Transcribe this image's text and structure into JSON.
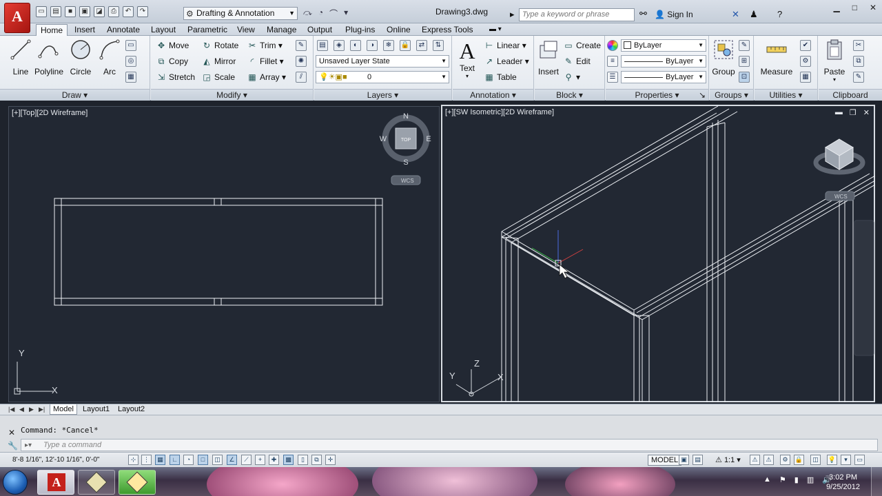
{
  "app": {
    "logo_letter": "A",
    "workspace": "Drafting & Annotation",
    "document_title": "Drawing3.dwg",
    "search_placeholder": "Type a keyword or phrase",
    "sign_in": "Sign In"
  },
  "ribbon_tabs": [
    "Home",
    "Insert",
    "Annotate",
    "Layout",
    "Parametric",
    "View",
    "Manage",
    "Output",
    "Plug-ins",
    "Online",
    "Express Tools"
  ],
  "active_tab": "Home",
  "draw_panel": {
    "title": "Draw",
    "buttons": [
      "Line",
      "Polyline",
      "Circle",
      "Arc"
    ]
  },
  "modify_panel": {
    "title": "Modify",
    "buttons": [
      "Move",
      "Rotate",
      "Trim",
      "Copy",
      "Mirror",
      "Fillet",
      "Stretch",
      "Scale",
      "Array"
    ]
  },
  "layers_panel": {
    "title": "Layers",
    "layer_state": "Unsaved Layer State",
    "current_layer": "0"
  },
  "annotation_panel": {
    "title": "Annotation",
    "text_label": "Text",
    "buttons": [
      "Linear",
      "Leader",
      "Table"
    ]
  },
  "block_panel": {
    "title": "Block",
    "insert_label": "Insert",
    "buttons": [
      "Create",
      "Edit"
    ]
  },
  "properties_panel": {
    "title": "Properties",
    "color": "ByLayer",
    "linetype": "ByLayer",
    "lineweight": "ByLayer"
  },
  "groups_panel": {
    "title": "Groups",
    "group_label": "Group"
  },
  "utilities_panel": {
    "title": "Utilities",
    "measure_label": "Measure"
  },
  "clipboard_panel": {
    "title": "Clipboard",
    "paste_label": "Paste"
  },
  "viewports": {
    "left_label": "[+][Top][2D Wireframe]",
    "right_label": "[+][SW Isometric][2D Wireframe]",
    "compass": {
      "n": "N",
      "s": "S",
      "e": "E",
      "w": "W",
      "top": "TOP"
    },
    "wcs": "WCS",
    "ucs_x": "X",
    "ucs_y": "Y",
    "ucs_z": "Z"
  },
  "layout_tabs": [
    "Model",
    "Layout1",
    "Layout2"
  ],
  "active_layout": "Model",
  "command": {
    "history": "Command: *Cancel*",
    "placeholder": "Type a command"
  },
  "status": {
    "coordinates": "8'-8 1/16\",  12'-10 1/16\", 0'-0\"",
    "model_label": "MODEL",
    "annotation_scale": "1:1"
  },
  "taskbar": {
    "time": "3:02 PM",
    "date": "9/25/2012"
  },
  "colors": {
    "canvas": "#222833",
    "linework": "#f2f4f7",
    "accent": "#c4211b"
  }
}
